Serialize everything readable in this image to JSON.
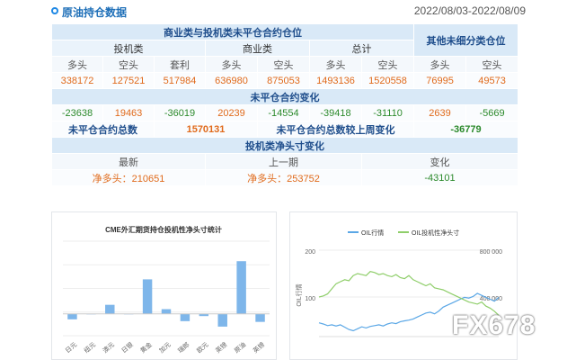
{
  "header": {
    "title": "原油持仓数据",
    "date_range": "2022/08/03-2022/08/09"
  },
  "table": {
    "section1_title": "商业类与投机类未平仓合约仓位",
    "other_title": "其他未细分类仓位",
    "group_spec": "投机类",
    "group_comm": "商业类",
    "group_total": "总计",
    "col_long": "多头",
    "col_short": "空头",
    "col_arb": "套利",
    "values": [
      "338172",
      "127521",
      "517984",
      "636980",
      "875053",
      "1493136",
      "1520558",
      "76995",
      "49573"
    ],
    "section2_title": "未平仓合约变化",
    "changes": [
      "-23638",
      "19463",
      "-36019",
      "20239",
      "-14554",
      "-39418",
      "-31110",
      "2639",
      "-5669"
    ],
    "oi_total_label": "未平仓合约总数",
    "oi_total_value": "1570131",
    "oi_change_label": "未平仓合约总数较上周变化",
    "oi_change_value": "-36779",
    "section3_title": "投机类净头寸变化",
    "latest_label": "最新",
    "prev_label": "上一期",
    "change_label": "变化",
    "latest_value": "净多头：210651",
    "prev_value": "净多头：253752",
    "change_value": "-43101"
  },
  "chart_data": [
    {
      "type": "bar",
      "title": "CME外汇期货持仓投机性净头寸统计",
      "categories": [
        "日元",
        "纽元",
        "澳元",
        "日银",
        "黄金",
        "加元",
        "瑞郎",
        "欧元",
        "英镑",
        "原油",
        "英镑"
      ],
      "values": [
        -1.5,
        0,
        2.5,
        0,
        9.5,
        1.3,
        -2.0,
        -0.6,
        -3.5,
        14.5,
        -2.2
      ],
      "ylim": [
        -6,
        20
      ],
      "grid": true,
      "legend": "none",
      "color": "#7eb6ea"
    },
    {
      "type": "line",
      "ylabel": "OIL行情",
      "yticks_left": [
        "200",
        "100"
      ],
      "yticks_right": [
        "800 000",
        "400 000"
      ],
      "series": [
        {
          "name": "OIL行情",
          "color": "#5aa7e6",
          "axis": "left",
          "values": [
            35,
            32,
            28,
            30,
            27,
            30,
            24,
            18,
            15,
            20,
            25,
            22,
            26,
            28,
            30,
            27,
            32,
            35,
            33,
            38,
            40,
            42,
            45,
            50,
            55,
            60,
            62,
            58,
            65,
            75,
            80,
            85,
            90,
            95,
            100,
            98,
            102,
            110,
            105,
            100,
            95,
            90,
            100
          ]
        },
        {
          "name": "OIL投机性净头寸",
          "color": "#8fce6a",
          "axis": "right",
          "values": [
            390,
            400,
            420,
            470,
            520,
            540,
            560,
            550,
            600,
            620,
            610,
            600,
            640,
            630,
            610,
            620,
            600,
            590,
            610,
            580,
            570,
            600,
            560,
            540,
            520,
            500,
            520,
            480,
            470,
            460,
            440,
            420,
            400,
            380,
            360,
            340,
            330,
            320,
            340,
            300,
            280,
            250,
            210
          ]
        }
      ],
      "legend": "top-center",
      "colors": {
        "oil": "#5aa7e6",
        "position": "#8fce6a"
      }
    }
  ],
  "watermark": "FX678"
}
